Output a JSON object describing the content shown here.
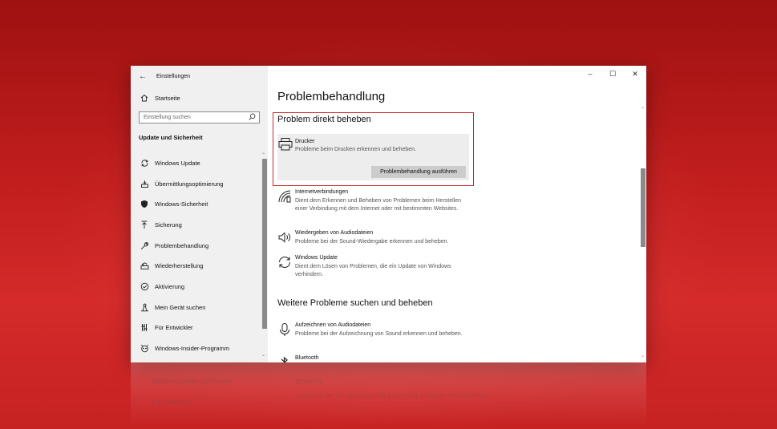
{
  "window": {
    "title": "Einstellungen"
  },
  "sidebar": {
    "home_label": "Startseite",
    "search_placeholder": "Einstellung suchen",
    "section_heading": "Update und Sicherheit",
    "items": [
      {
        "label": "Windows Update",
        "icon": "sync-icon"
      },
      {
        "label": "Übermittlungsoptimierung",
        "icon": "delivery-optimization-icon"
      },
      {
        "label": "Windows-Sicherheit",
        "icon": "shield-icon"
      },
      {
        "label": "Sicherung",
        "icon": "backup-arrow-icon"
      },
      {
        "label": "Problembehandlung",
        "icon": "wrench-icon"
      },
      {
        "label": "Wiederherstellung",
        "icon": "recovery-icon"
      },
      {
        "label": "Aktivierung",
        "icon": "check-circle-icon"
      },
      {
        "label": "Mein Gerät suchen",
        "icon": "find-device-icon"
      },
      {
        "label": "Für Entwickler",
        "icon": "developer-icon"
      },
      {
        "label": "Windows-Insider-Programm",
        "icon": "insider-icon"
      }
    ]
  },
  "content": {
    "page_title": "Problembehandlung",
    "section1_heading": "Problem direkt beheben",
    "printer": {
      "title": "Drucker",
      "description": "Probleme beim Drucken erkennen und beheben.",
      "button_label": "Problembehandlung ausführen"
    },
    "troubleshooters": [
      {
        "title": "Internetverbindungen",
        "description": "Dient dem Erkennen und Beheben von Problemen beim Herstellen einer Verbindung mit dem Internet oder mit bestimmten Websites.",
        "icon": "network-icon"
      },
      {
        "title": "Wiedergeben von Audiodateien",
        "description": "Probleme bei der Sound-Wiedergabe erkennen und beheben.",
        "icon": "speaker-icon"
      },
      {
        "title": "Windows Update",
        "description": "Dient dem Lösen von Problemen, die ein Update von Windows verhindern.",
        "icon": "sync-icon"
      }
    ],
    "section2_heading": "Weitere Probleme suchen und beheben",
    "more_troubleshooters": [
      {
        "title": "Aufzeichnen von Audiodateien",
        "description": "Probleme bei der Aufzeichnung von Sound erkennen und beheben.",
        "icon": "microphone-icon"
      },
      {
        "title": "Bluetooth",
        "description": "",
        "icon": "bluetooth-icon"
      }
    ]
  },
  "colors": {
    "background": "#c41f1f",
    "highlight_border": "#c62828",
    "card_bg": "#ededed",
    "button_bg": "#cccccc"
  }
}
